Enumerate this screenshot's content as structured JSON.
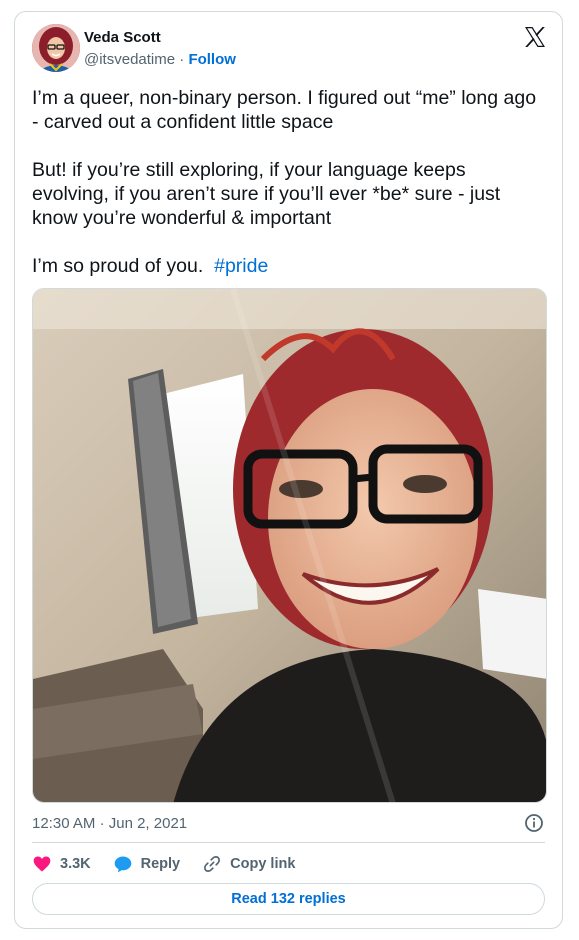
{
  "author": {
    "name": "Veda Scott",
    "handle": "@itsvedatime",
    "separator": "·",
    "follow_label": "Follow",
    "avatar_icon": "profile-photo"
  },
  "brand_icon": "x-logo-icon",
  "tweet": {
    "paragraph1": "I’m a queer, non-binary person. I figured out “me” long ago - carved out a confident little space",
    "paragraph2": "But! if you’re still exploring, if your language keeps evolving, if you aren’t sure if you’ll ever *be* sure - just know you’re wonderful & important",
    "paragraph3_text": "I’m so proud of you.",
    "hashtag": "#pride"
  },
  "meta": {
    "time": "12:30 AM",
    "separator": "·",
    "date": "Jun 2, 2021",
    "info_icon": "info-icon"
  },
  "actions": {
    "likes": "3.3K",
    "reply_label": "Reply",
    "copy_link_label": "Copy link"
  },
  "read_replies_label": "Read 132 replies",
  "colors": {
    "link": "#006fd6",
    "heart": "#f91880",
    "reply": "#1d9bf0",
    "border": "#cfd9de",
    "secondary_text": "#536471"
  }
}
